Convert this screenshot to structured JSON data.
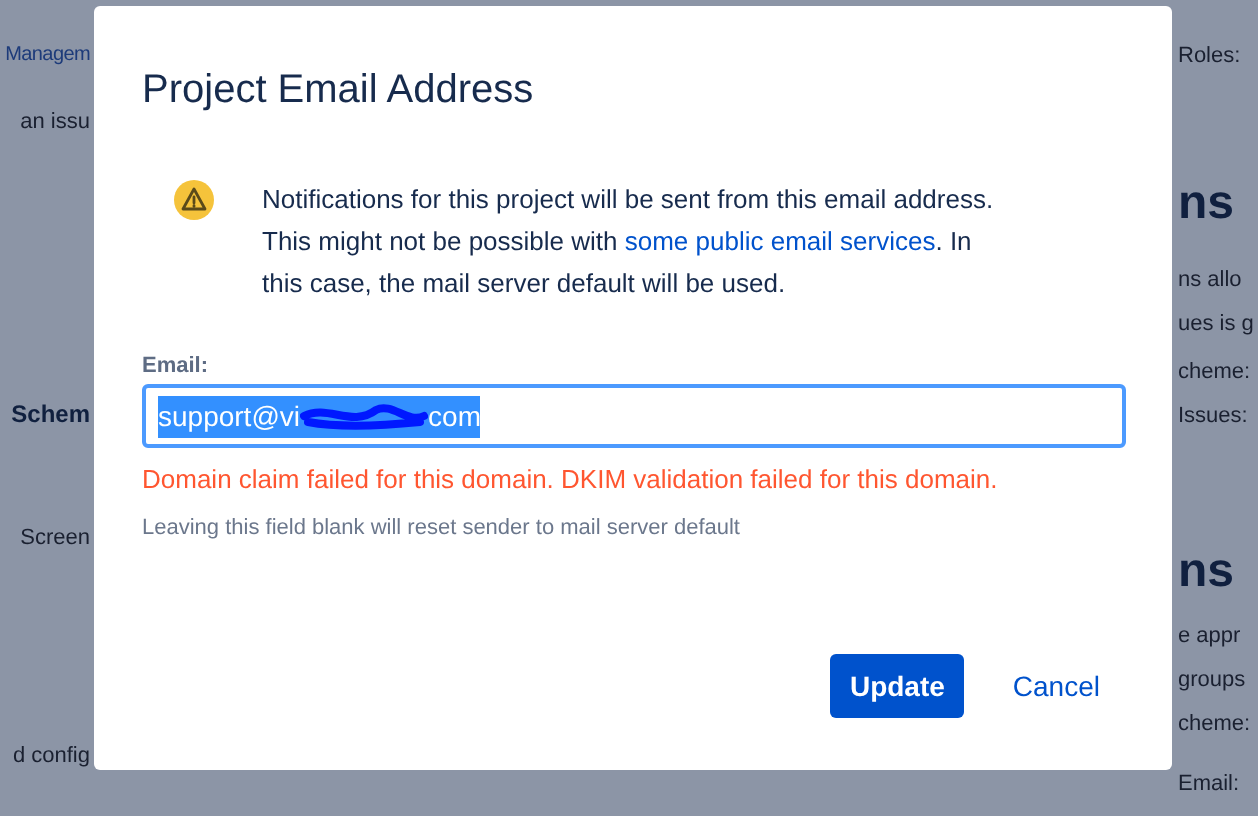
{
  "background_page": {
    "left": [
      {
        "text": "Managem",
        "kind": "link"
      },
      {
        "text": "an issu",
        "kind": "text"
      },
      {
        "text": "Schem",
        "kind": "heading"
      },
      {
        "text": "Screen",
        "kind": "text"
      },
      {
        "text": "d config",
        "kind": "text"
      }
    ],
    "right": [
      {
        "text": "Roles:",
        "kind": "text"
      },
      {
        "text": "ns",
        "kind": "heading"
      },
      {
        "text": "ns allo",
        "kind": "text"
      },
      {
        "text": "ues is g",
        "kind": "text"
      },
      {
        "text": "cheme:",
        "kind": "text"
      },
      {
        "text": "Issues:",
        "kind": "text"
      },
      {
        "text": "ns",
        "kind": "heading"
      },
      {
        "text": "e appr",
        "kind": "text"
      },
      {
        "text": "groups",
        "kind": "text"
      },
      {
        "text": "cheme:",
        "kind": "text"
      },
      {
        "text": "Email:",
        "kind": "text"
      }
    ]
  },
  "dialog": {
    "title": "Project Email Address",
    "notice": "Notifications for this project will be sent from this email address. This might not be possible with ",
    "notice_link": "some public email services",
    "notice_end": ". In this case, the mail server default will be used.",
    "email": {
      "label": "Email:",
      "value_start": "support@vi",
      "value_end": "com",
      "selected": true
    },
    "error": "Domain claim failed for this domain. DKIM validation failed for this domain.",
    "hint": "Leaving this field blank will reset sender to mail server default",
    "buttons": [
      {
        "label": "Update",
        "kind": "primary"
      },
      {
        "label": "Cancel",
        "kind": "link"
      }
    ]
  }
}
